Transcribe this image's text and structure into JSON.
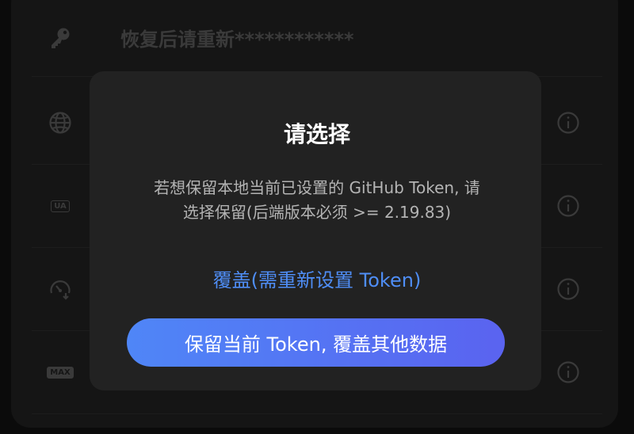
{
  "background": {
    "rows": [
      {
        "title": "恢复后请重新************",
        "icon": "key-icon"
      },
      {
        "title": "",
        "icon": "globe-icon"
      },
      {
        "title": "",
        "icon": "ua-icon",
        "badge": "UA"
      },
      {
        "title": "",
        "icon": "gauge-icon"
      },
      {
        "title": "",
        "icon": "max-icon",
        "badge": "MAX"
      }
    ]
  },
  "dialog": {
    "title": "请选择",
    "message_line1": "若想保留本地当前已设置的 GitHub Token, 请",
    "message_line2": "选择保留(后端版本必须 >= 2.19.83)",
    "overwrite_label": "覆盖(需重新设置 Token)",
    "keep_label": "保留当前 Token, 覆盖其他数据"
  },
  "colors": {
    "accent": "#4f8ef7",
    "button_gradient_start": "#4f86f7",
    "button_gradient_end": "#5a63f0",
    "dialog_bg": "#222222"
  }
}
